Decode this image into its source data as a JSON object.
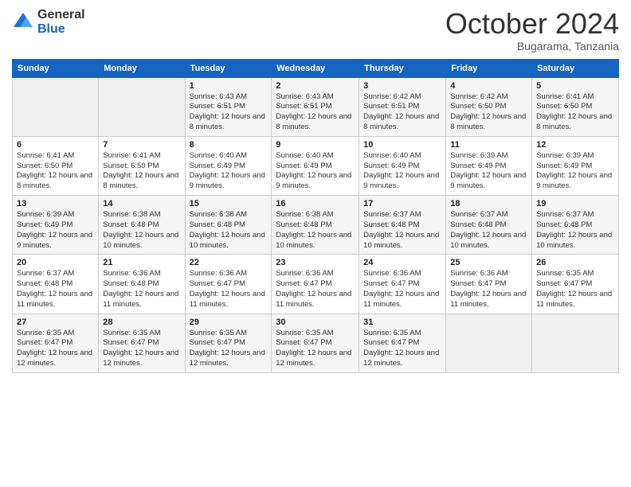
{
  "logo": {
    "general": "General",
    "blue": "Blue"
  },
  "header": {
    "month": "October 2024",
    "location": "Bugarama, Tanzania"
  },
  "weekdays": [
    "Sunday",
    "Monday",
    "Tuesday",
    "Wednesday",
    "Thursday",
    "Friday",
    "Saturday"
  ],
  "weeks": [
    [
      {
        "day": "",
        "info": ""
      },
      {
        "day": "",
        "info": ""
      },
      {
        "day": "1",
        "info": "Sunrise: 6:43 AM\nSunset: 6:51 PM\nDaylight: 12 hours and 8 minutes."
      },
      {
        "day": "2",
        "info": "Sunrise: 6:43 AM\nSunset: 6:51 PM\nDaylight: 12 hours and 8 minutes."
      },
      {
        "day": "3",
        "info": "Sunrise: 6:42 AM\nSunset: 6:51 PM\nDaylight: 12 hours and 8 minutes."
      },
      {
        "day": "4",
        "info": "Sunrise: 6:42 AM\nSunset: 6:50 PM\nDaylight: 12 hours and 8 minutes."
      },
      {
        "day": "5",
        "info": "Sunrise: 6:41 AM\nSunset: 6:50 PM\nDaylight: 12 hours and 8 minutes."
      }
    ],
    [
      {
        "day": "6",
        "info": "Sunrise: 6:41 AM\nSunset: 6:50 PM\nDaylight: 12 hours and 8 minutes."
      },
      {
        "day": "7",
        "info": "Sunrise: 6:41 AM\nSunset: 6:50 PM\nDaylight: 12 hours and 8 minutes."
      },
      {
        "day": "8",
        "info": "Sunrise: 6:40 AM\nSunset: 6:49 PM\nDaylight: 12 hours and 9 minutes."
      },
      {
        "day": "9",
        "info": "Sunrise: 6:40 AM\nSunset: 6:49 PM\nDaylight: 12 hours and 9 minutes."
      },
      {
        "day": "10",
        "info": "Sunrise: 6:40 AM\nSunset: 6:49 PM\nDaylight: 12 hours and 9 minutes."
      },
      {
        "day": "11",
        "info": "Sunrise: 6:39 AM\nSunset: 6:49 PM\nDaylight: 12 hours and 9 minutes."
      },
      {
        "day": "12",
        "info": "Sunrise: 6:39 AM\nSunset: 6:49 PM\nDaylight: 12 hours and 9 minutes."
      }
    ],
    [
      {
        "day": "13",
        "info": "Sunrise: 6:39 AM\nSunset: 6:49 PM\nDaylight: 12 hours and 9 minutes."
      },
      {
        "day": "14",
        "info": "Sunrise: 6:38 AM\nSunset: 6:48 PM\nDaylight: 12 hours and 10 minutes."
      },
      {
        "day": "15",
        "info": "Sunrise: 6:38 AM\nSunset: 6:48 PM\nDaylight: 12 hours and 10 minutes."
      },
      {
        "day": "16",
        "info": "Sunrise: 6:38 AM\nSunset: 6:48 PM\nDaylight: 12 hours and 10 minutes."
      },
      {
        "day": "17",
        "info": "Sunrise: 6:37 AM\nSunset: 6:48 PM\nDaylight: 12 hours and 10 minutes."
      },
      {
        "day": "18",
        "info": "Sunrise: 6:37 AM\nSunset: 6:48 PM\nDaylight: 12 hours and 10 minutes."
      },
      {
        "day": "19",
        "info": "Sunrise: 6:37 AM\nSunset: 6:48 PM\nDaylight: 12 hours and 10 minutes."
      }
    ],
    [
      {
        "day": "20",
        "info": "Sunrise: 6:37 AM\nSunset: 6:48 PM\nDaylight: 12 hours and 11 minutes."
      },
      {
        "day": "21",
        "info": "Sunrise: 6:36 AM\nSunset: 6:48 PM\nDaylight: 12 hours and 11 minutes."
      },
      {
        "day": "22",
        "info": "Sunrise: 6:36 AM\nSunset: 6:47 PM\nDaylight: 12 hours and 11 minutes."
      },
      {
        "day": "23",
        "info": "Sunrise: 6:36 AM\nSunset: 6:47 PM\nDaylight: 12 hours and 11 minutes."
      },
      {
        "day": "24",
        "info": "Sunrise: 6:36 AM\nSunset: 6:47 PM\nDaylight: 12 hours and 11 minutes."
      },
      {
        "day": "25",
        "info": "Sunrise: 6:36 AM\nSunset: 6:47 PM\nDaylight: 12 hours and 11 minutes."
      },
      {
        "day": "26",
        "info": "Sunrise: 6:35 AM\nSunset: 6:47 PM\nDaylight: 12 hours and 11 minutes."
      }
    ],
    [
      {
        "day": "27",
        "info": "Sunrise: 6:35 AM\nSunset: 6:47 PM\nDaylight: 12 hours and 12 minutes."
      },
      {
        "day": "28",
        "info": "Sunrise: 6:35 AM\nSunset: 6:47 PM\nDaylight: 12 hours and 12 minutes."
      },
      {
        "day": "29",
        "info": "Sunrise: 6:35 AM\nSunset: 6:47 PM\nDaylight: 12 hours and 12 minutes."
      },
      {
        "day": "30",
        "info": "Sunrise: 6:35 AM\nSunset: 6:47 PM\nDaylight: 12 hours and 12 minutes."
      },
      {
        "day": "31",
        "info": "Sunrise: 6:35 AM\nSunset: 6:47 PM\nDaylight: 12 hours and 12 minutes."
      },
      {
        "day": "",
        "info": ""
      },
      {
        "day": "",
        "info": ""
      }
    ]
  ]
}
